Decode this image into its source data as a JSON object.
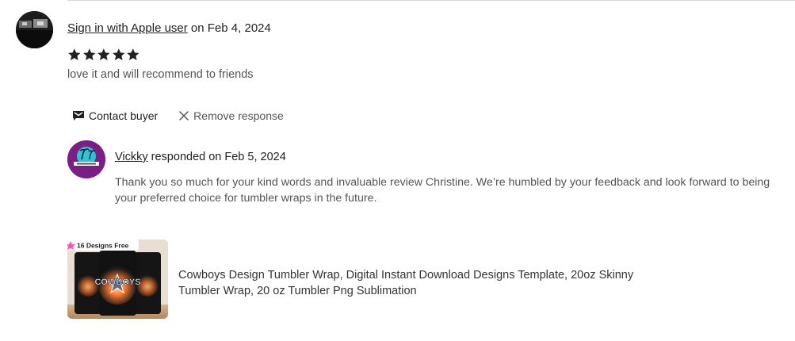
{
  "review": {
    "reviewer_name": "Sign in with Apple user",
    "date_prefix": " on ",
    "date": "Feb 4, 2024",
    "rating": 5,
    "text": "love it and will recommend to friends"
  },
  "actions": {
    "contact_label": "Contact buyer",
    "remove_label": "Remove response"
  },
  "response": {
    "seller_name": "Vickky",
    "responded_prefix": " responded on ",
    "date": "Feb 5, 2024",
    "text": "Thank you so much for your kind words and invaluable review Christine. We’re humbled by your feedback and look forward to being your preferred choice for tumbler wraps in the future."
  },
  "product": {
    "badge": "16 Designs Free",
    "thumb_text": "COWBOYS",
    "title": "Cowboys Design Tumbler Wrap, Digital Instant Download Designs Template, 20oz Skinny Tumbler Wrap, 20 oz Tumbler Png Sublimation"
  },
  "icons": {
    "star": "star-icon",
    "contact": "mail-icon",
    "remove": "close-icon"
  },
  "colors": {
    "star": "#222222",
    "seller_avatar_bg": "#7a1f86",
    "muted_text": "#555555"
  }
}
